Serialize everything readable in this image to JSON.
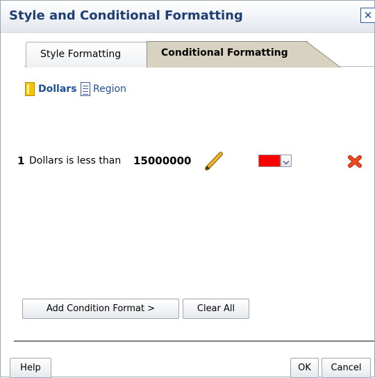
{
  "dialog": {
    "title": "Style and Conditional Formatting",
    "close_glyph": "✕"
  },
  "tabs": [
    {
      "label": "Style Formatting",
      "selected": false
    },
    {
      "label": "Conditional Formatting",
      "selected": true
    }
  ],
  "measures": [
    {
      "label": "Dollars",
      "icon": "measure-column-icon",
      "selected": true
    },
    {
      "label": "Region",
      "icon": "attribute-column-icon",
      "selected": false
    }
  ],
  "conditions": [
    {
      "number": "1",
      "text": "Dollars is less than",
      "value": "15000000",
      "edit_icon": "pencil-icon",
      "color": "#ff0000",
      "delete_icon": "delete-x-icon"
    }
  ],
  "buttons": {
    "add_condition": "Add Condition Format >",
    "clear_all": "Clear All",
    "help": "Help",
    "ok": "OK",
    "cancel": "Cancel"
  },
  "colors": {
    "title_text": "#1f3e72",
    "link_text": "#1f4e95",
    "selected_tab": "#d8d2c0",
    "condition_color": "#ff0000",
    "delete_red": "#d93a12"
  }
}
